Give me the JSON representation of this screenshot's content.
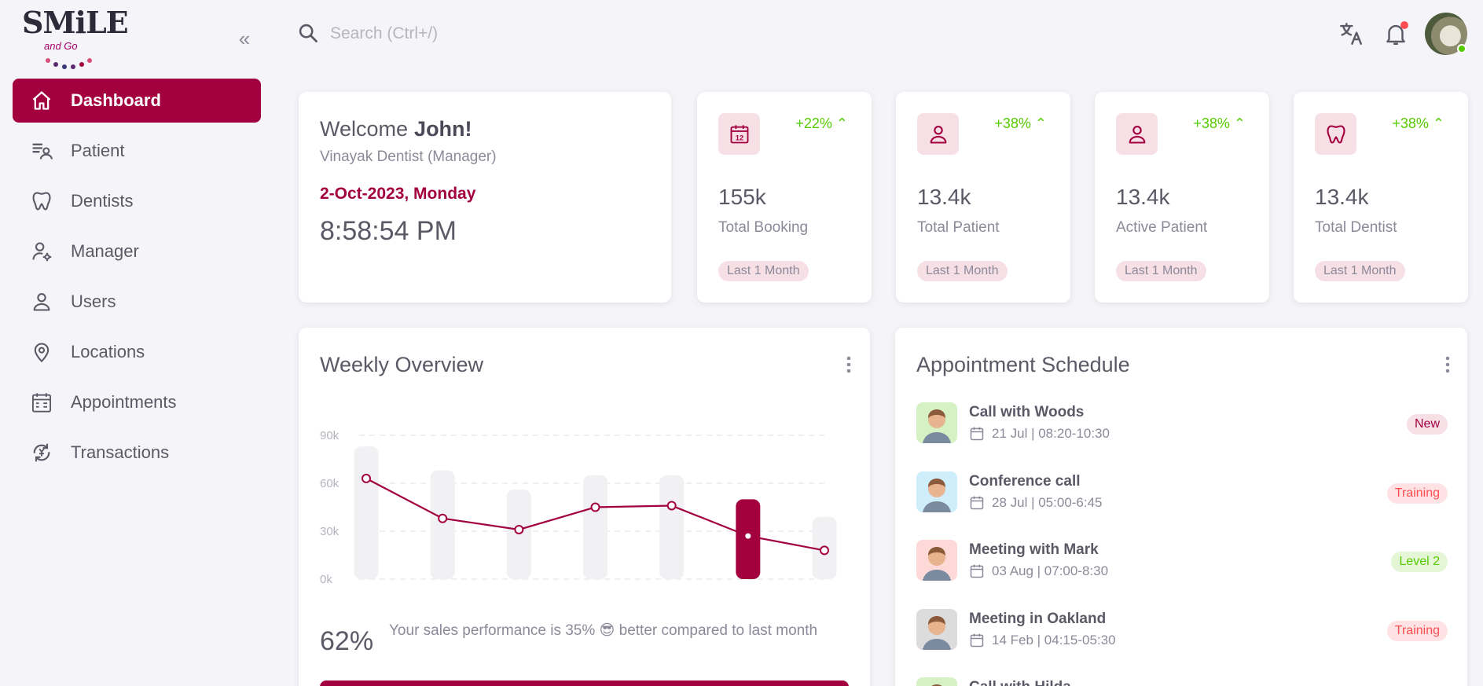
{
  "brand": {
    "logo_main": "SMiLE",
    "logo_sub": "and Go"
  },
  "sidebar": {
    "items": [
      {
        "label": "Dashboard",
        "icon": "home-icon",
        "active": true
      },
      {
        "label": "Patient",
        "icon": "patient-list-icon"
      },
      {
        "label": "Dentists",
        "icon": "tooth-icon"
      },
      {
        "label": "Manager",
        "icon": "user-gear-icon"
      },
      {
        "label": "Users",
        "icon": "user-icon"
      },
      {
        "label": "Locations",
        "icon": "map-pin-icon"
      },
      {
        "label": "Appointments",
        "icon": "calendar-icon"
      },
      {
        "label": "Transactions",
        "icon": "currency-exchange-icon"
      }
    ]
  },
  "topbar": {
    "search_placeholder": "Search (Ctrl+/)"
  },
  "welcome": {
    "greeting": "Welcome",
    "name": "John!",
    "subtitle": "Vinayak Dentist (Manager)",
    "date": "2-Oct-2023, Monday",
    "time": "8:58:54 PM"
  },
  "stats": [
    {
      "change": "+22%",
      "value": "155k",
      "label": "Total Booking",
      "badge": "Last 1 Month",
      "icon": "calendar-12-icon"
    },
    {
      "change": "+38%",
      "value": "13.4k",
      "label": "Total Patient",
      "badge": "Last 1 Month",
      "icon": "user-icon"
    },
    {
      "change": "+38%",
      "value": "13.4k",
      "label": "Active Patient",
      "badge": "Last 1 Month",
      "icon": "user-icon"
    },
    {
      "change": "+38%",
      "value": "13.4k",
      "label": "Total Dentist",
      "badge": "Last 1 Month",
      "icon": "tooth-icon"
    }
  ],
  "weekly": {
    "title": "Weekly Overview",
    "performance_value": "62%",
    "performance_text": "Your sales performance is 35% 😎 better compared to last month"
  },
  "chart_data": {
    "type": "bar",
    "title": "Weekly Overview",
    "y_ticks": [
      "0k",
      "30k",
      "60k",
      "90k"
    ],
    "ylim": [
      0,
      90
    ],
    "grid": true,
    "highlight_index": 5,
    "series": [
      {
        "type": "bar",
        "values": [
          83,
          68,
          56,
          65,
          65,
          50,
          39
        ]
      },
      {
        "type": "line",
        "values": [
          63,
          38,
          31,
          45,
          46,
          27,
          18
        ]
      }
    ],
    "colors": {
      "bar": "#f1f0f2",
      "highlight": "#a3003f",
      "line": "#a3003f"
    }
  },
  "schedule": {
    "title": "Appointment Schedule",
    "items": [
      {
        "title": "Call with Woods",
        "time": "21 Jul | 08:20-10:30",
        "badge": "New",
        "badge_color": "#a3003f",
        "badge_bg": "#f7dfe6",
        "avatar_bg": "#d6f2c5"
      },
      {
        "title": "Conference call",
        "time": "28 Jul | 05:00-6:45",
        "badge": "Training",
        "badge_color": "#ff4c51",
        "badge_bg": "#ffe3e4",
        "avatar_bg": "#cdeefa"
      },
      {
        "title": "Meeting with Mark",
        "time": "03 Aug | 07:00-8:30",
        "badge": "Level 2",
        "badge_color": "#56ca00",
        "badge_bg": "#e4f6d6",
        "avatar_bg": "#ffd8d8"
      },
      {
        "title": "Meeting in Oakland",
        "time": "14 Feb | 04:15-05:30",
        "badge": "Training",
        "badge_color": "#ff4c51",
        "badge_bg": "#ffe3e4",
        "avatar_bg": "#dcdcdc"
      },
      {
        "title": "Call with Hilda",
        "time": "",
        "badge": "",
        "badge_color": "#56ca00",
        "badge_bg": "#e4f6d6",
        "avatar_bg": "#d6f2c5"
      }
    ]
  }
}
